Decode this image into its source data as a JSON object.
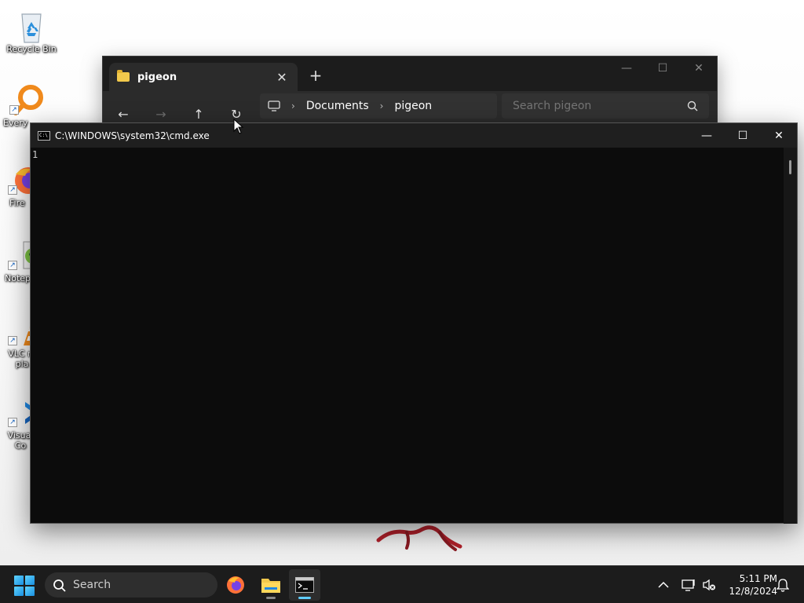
{
  "desktop": {
    "icons": [
      {
        "label": "Recycle Bin"
      },
      {
        "label": "Every"
      },
      {
        "label": "Fire"
      },
      {
        "label": "Notep"
      },
      {
        "label": "VLC m pla"
      },
      {
        "label": "Visual Co"
      }
    ]
  },
  "explorer": {
    "tab_label": "pigeon",
    "tab_close": "✕",
    "new_tab": "+",
    "nav": {
      "back": "←",
      "forward": "→",
      "up": "↑",
      "refresh": "↻"
    },
    "breadcrumb": [
      "Documents",
      "pigeon"
    ],
    "breadcrumb_sep": "›",
    "search_placeholder": "Search pigeon",
    "controls": {
      "minimize": "—",
      "maximize": "☐",
      "close": "✕"
    }
  },
  "cmd": {
    "title": "C:\\WINDOWS\\system32\\cmd.exe",
    "icon_text": "C:\\",
    "output": "1",
    "controls": {
      "minimize": "—",
      "maximize": "☐",
      "close": "✕"
    }
  },
  "taskbar": {
    "search_label": "Search",
    "apps": [
      "firefox",
      "file-explorer",
      "terminal"
    ],
    "time": "5:11 PM",
    "date": "12/8/2024"
  },
  "colors": {
    "accent": "#60cdff",
    "folder": "#f2c94c",
    "console_bg": "#0c0c0c",
    "taskbar_bg": "#1c1c1c"
  }
}
